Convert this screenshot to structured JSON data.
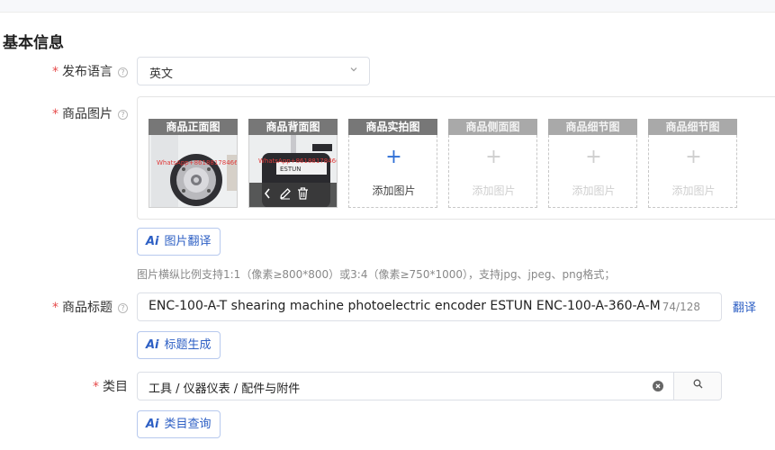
{
  "section_title": "基本信息",
  "language": {
    "label": "发布语言",
    "value": "英文"
  },
  "images": {
    "label": "商品图片",
    "slots": [
      {
        "header": "商品正面图",
        "watermark": "WhatsApp+8618817846686"
      },
      {
        "header": "商品背面图",
        "watermark": "WhatsApp+8618817846686"
      },
      {
        "header": "商品实拍图",
        "add_label": "添加图片"
      },
      {
        "header": "商品侧面图",
        "add_label": "添加图片"
      },
      {
        "header": "商品细节图",
        "add_label": "添加图片"
      },
      {
        "header": "商品细节图",
        "add_label": "添加图片"
      }
    ],
    "translate_button": "图片翻译",
    "hint": "图片横纵比例支持1:1（像素≥800*800）或3:4（像素≥750*1000），支持jpg、jpeg、png格式；"
  },
  "title": {
    "label": "商品标题",
    "value": "ENC-100-A-T shearing machine photoelectric encoder ESTUN ENC-100-A-360-A-M",
    "count": "74/128",
    "translate_link": "翻译",
    "generate_button": "标题生成"
  },
  "category": {
    "label": "类目",
    "value": "工具 / 仪器仪表 / 配件与附件",
    "query_button": "类目查询"
  },
  "ai_icon_text": "Ai",
  "required_mark": "*",
  "help_glyph": "?",
  "colors": {
    "accent": "#2d5fc4",
    "required": "#e64b4b",
    "slot_header": "#777777"
  }
}
